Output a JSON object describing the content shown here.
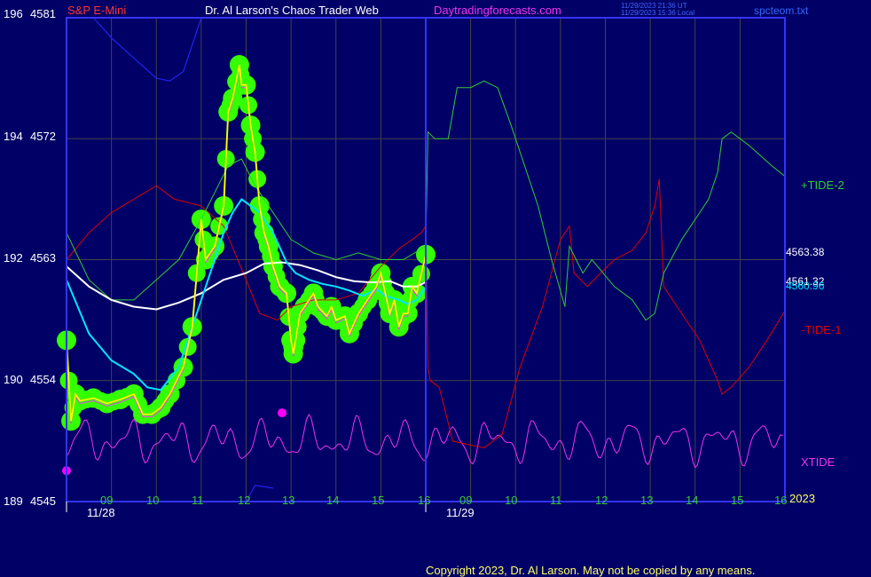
{
  "header": {
    "symbol": "S&P E-Mini",
    "author": "Dr. Al Larson's Chaos Trader Web",
    "site": "Daytradingforecasts.com",
    "ts_ut": "11/29/2023 21:36 UT",
    "ts_local": "11/29/2023 15:36 Local",
    "file": "spcteom.txt"
  },
  "footer": {
    "copyright": "Copyright 2023, Dr. Al Larson. May not be copied by any means."
  },
  "colors": {
    "background": "#000066",
    "frame": "#3333ff",
    "grid": "#444444",
    "price": "#ffff00",
    "glow": "#33ff00",
    "ema_fast": "#00e5ff",
    "ema_slow": "#ffffff",
    "tide_plus": "#33cc33",
    "tide_minus": "#dd0000",
    "xtide": "#ee33ee",
    "blue_line": "#2222ee",
    "markers": "#ff00ff"
  },
  "chart_data": {
    "type": "line",
    "title": "S&P E-Mini",
    "y_axis": {
      "ticks": [
        {
          "left": "196",
          "right": "4581"
        },
        {
          "left": "194",
          "right": "4572"
        },
        {
          "left": "192",
          "right": "4563"
        },
        {
          "left": "190",
          "right": "4554"
        },
        {
          "left": "189",
          "right": "4545"
        }
      ],
      "ylim": [
        4545,
        4581
      ]
    },
    "x_axis": {
      "hour_ticks": [
        "09",
        "10",
        "11",
        "12",
        "13",
        "14",
        "15",
        "16",
        "09",
        "10",
        "11",
        "12",
        "13",
        "14",
        "15",
        "16"
      ],
      "dates": [
        "11/28",
        "11/29"
      ],
      "year": "2023"
    },
    "right_labels": {
      "tide_plus": "+TIDE-2",
      "tide_minus": "-TIDE-1",
      "xtide": "XTIDE",
      "value_a": "4563.38",
      "value_b": "4561.32",
      "value_c": "4560.96"
    },
    "series": [
      {
        "name": "price",
        "points": [
          [
            8.0,
            4557
          ],
          [
            8.1,
            4551
          ],
          [
            8.2,
            4553
          ],
          [
            8.3,
            4552.5
          ],
          [
            8.6,
            4552.7
          ],
          [
            8.9,
            4552.3
          ],
          [
            9.2,
            4552.6
          ],
          [
            9.5,
            4553
          ],
          [
            9.7,
            4551.5
          ],
          [
            9.9,
            4551.5
          ],
          [
            10.1,
            4552
          ],
          [
            10.3,
            4553
          ],
          [
            10.6,
            4555
          ],
          [
            10.8,
            4558
          ],
          [
            11.0,
            4566
          ],
          [
            11.1,
            4563
          ],
          [
            11.3,
            4564
          ],
          [
            11.5,
            4567
          ],
          [
            11.6,
            4574
          ],
          [
            11.7,
            4575
          ],
          [
            11.85,
            4577.5
          ],
          [
            11.9,
            4576
          ],
          [
            12.0,
            4576
          ],
          [
            12.1,
            4573
          ],
          [
            12.2,
            4571
          ],
          [
            12.3,
            4567
          ],
          [
            12.4,
            4565
          ],
          [
            12.5,
            4564
          ],
          [
            12.6,
            4562.5
          ],
          [
            12.75,
            4561
          ],
          [
            12.9,
            4560.5
          ],
          [
            13.0,
            4557
          ],
          [
            13.05,
            4556
          ],
          [
            13.1,
            4557
          ],
          [
            13.2,
            4559
          ],
          [
            13.3,
            4559.5
          ],
          [
            13.5,
            4560.5
          ],
          [
            13.6,
            4559.5
          ],
          [
            13.8,
            4558.8
          ],
          [
            13.9,
            4559.5
          ],
          [
            14.0,
            4558.5
          ],
          [
            14.2,
            4558.8
          ],
          [
            14.3,
            4557.5
          ],
          [
            14.5,
            4559
          ],
          [
            14.7,
            4560
          ],
          [
            14.9,
            4561
          ],
          [
            15.0,
            4562
          ],
          [
            15.1,
            4560.5
          ],
          [
            15.2,
            4559
          ],
          [
            15.3,
            4560
          ],
          [
            15.4,
            4558
          ],
          [
            15.5,
            4559
          ],
          [
            15.6,
            4559
          ],
          [
            15.7,
            4561
          ],
          [
            15.8,
            4560.5
          ],
          [
            16.0,
            4563.38
          ]
        ]
      },
      {
        "name": "fast-avg",
        "points": [
          [
            8.0,
            4561.5
          ],
          [
            8.5,
            4557.5
          ],
          [
            9.0,
            4555.5
          ],
          [
            9.5,
            4554.5
          ],
          [
            9.8,
            4553.5
          ],
          [
            10.1,
            4553.3
          ],
          [
            10.5,
            4555
          ],
          [
            11.0,
            4560
          ],
          [
            11.5,
            4565
          ],
          [
            11.7,
            4566.5
          ],
          [
            11.9,
            4567.5
          ],
          [
            12.1,
            4567
          ],
          [
            12.3,
            4566.5
          ],
          [
            12.6,
            4565
          ],
          [
            12.9,
            4562.8
          ],
          [
            13.1,
            4562
          ],
          [
            13.4,
            4561.5
          ],
          [
            13.7,
            4561.2
          ],
          [
            14.0,
            4561
          ],
          [
            14.3,
            4560.7
          ],
          [
            14.6,
            4560.3
          ],
          [
            14.9,
            4560.8
          ],
          [
            15.1,
            4560.3
          ],
          [
            15.4,
            4560
          ],
          [
            15.6,
            4559.7
          ],
          [
            15.8,
            4560
          ],
          [
            16.0,
            4560.96
          ]
        ]
      },
      {
        "name": "slow-avg",
        "points": [
          [
            8.0,
            4562.5
          ],
          [
            8.5,
            4561
          ],
          [
            9.0,
            4560
          ],
          [
            9.5,
            4559.5
          ],
          [
            10.0,
            4559.3
          ],
          [
            10.5,
            4559.8
          ],
          [
            11.0,
            4560.5
          ],
          [
            11.5,
            4561.5
          ],
          [
            12.0,
            4562
          ],
          [
            12.4,
            4562.7
          ],
          [
            12.8,
            4562.8
          ],
          [
            13.2,
            4562.6
          ],
          [
            13.6,
            4562.2
          ],
          [
            14.0,
            4561.7
          ],
          [
            14.4,
            4561.4
          ],
          [
            14.8,
            4561.3
          ],
          [
            15.2,
            4561.4
          ],
          [
            15.5,
            4561
          ],
          [
            15.8,
            4561
          ],
          [
            16.0,
            4561.32
          ]
        ]
      },
      {
        "name": "+TIDE-2",
        "points": [
          [
            8.0,
            4565
          ],
          [
            8.5,
            4561.5
          ],
          [
            9.0,
            4560
          ],
          [
            9.5,
            4560
          ],
          [
            10.0,
            4561.5
          ],
          [
            10.5,
            4563
          ],
          [
            11.0,
            4566
          ],
          [
            11.3,
            4568
          ],
          [
            11.6,
            4570
          ],
          [
            11.9,
            4570.5
          ],
          [
            12.2,
            4568.5
          ],
          [
            12.6,
            4566.5
          ],
          [
            13.0,
            4564.5
          ],
          [
            13.5,
            4563.5
          ],
          [
            14.0,
            4563
          ],
          [
            14.5,
            4563.5
          ],
          [
            15.0,
            4563
          ],
          [
            15.5,
            4563
          ],
          [
            16.0,
            4564
          ],
          [
            16.05,
            4572.5
          ],
          [
            16.2,
            4572
          ],
          [
            16.5,
            4572
          ],
          [
            16.7,
            4575.8
          ],
          [
            17.0,
            4575.8
          ],
          [
            17.3,
            4576.3
          ],
          [
            17.6,
            4575.8
          ],
          [
            17.9,
            4573
          ],
          [
            18.2,
            4570
          ],
          [
            18.5,
            4567
          ],
          [
            18.8,
            4563
          ],
          [
            19.1,
            4559.5
          ],
          [
            19.2,
            4564
          ],
          [
            19.5,
            4562
          ],
          [
            19.7,
            4563
          ],
          [
            19.9,
            4562.2
          ],
          [
            20.2,
            4561
          ],
          [
            20.6,
            4560
          ],
          [
            20.9,
            4558.5
          ],
          [
            21.1,
            4559
          ],
          [
            21.3,
            4562
          ],
          [
            21.7,
            4564.5
          ],
          [
            22.0,
            4566
          ],
          [
            22.3,
            4567.5
          ],
          [
            22.5,
            4569.5
          ],
          [
            22.6,
            4572
          ],
          [
            22.8,
            4572.5
          ],
          [
            23.2,
            4571.5
          ],
          [
            23.7,
            4570
          ],
          [
            24.0,
            4569.2
          ]
        ]
      },
      {
        "name": "-TIDE-1",
        "points": [
          [
            8.0,
            4563
          ],
          [
            8.5,
            4565
          ],
          [
            9.0,
            4566.5
          ],
          [
            9.5,
            4567.5
          ],
          [
            10.0,
            4568.5
          ],
          [
            10.4,
            4567.5
          ],
          [
            11.0,
            4567
          ],
          [
            11.5,
            4565.5
          ],
          [
            12.0,
            4561.5
          ],
          [
            12.3,
            4559
          ],
          [
            12.7,
            4558.5
          ],
          [
            13.0,
            4559.5
          ],
          [
            13.5,
            4560
          ],
          [
            14.0,
            4560
          ],
          [
            14.5,
            4560.5
          ],
          [
            15.0,
            4562.5
          ],
          [
            15.4,
            4563.8
          ],
          [
            15.7,
            4564.5
          ],
          [
            15.9,
            4565
          ],
          [
            16.0,
            4565.5
          ],
          [
            16.05,
            4555
          ],
          [
            16.1,
            4554
          ],
          [
            16.3,
            4553.5
          ],
          [
            16.6,
            4549.5
          ],
          [
            17.0,
            4549.2
          ],
          [
            17.3,
            4549
          ],
          [
            17.7,
            4550
          ],
          [
            18.1,
            4555
          ],
          [
            18.6,
            4559.5
          ],
          [
            19.0,
            4564.5
          ],
          [
            19.2,
            4565.5
          ],
          [
            19.3,
            4562
          ],
          [
            19.6,
            4561
          ],
          [
            19.9,
            4562
          ],
          [
            20.2,
            4563
          ],
          [
            20.6,
            4563.7
          ],
          [
            20.9,
            4565
          ],
          [
            21.1,
            4567
          ],
          [
            21.2,
            4569
          ],
          [
            21.3,
            4561
          ],
          [
            21.7,
            4559
          ],
          [
            22.1,
            4557
          ],
          [
            22.5,
            4554
          ],
          [
            22.6,
            4553
          ],
          [
            22.8,
            4553.5
          ],
          [
            23.2,
            4555
          ],
          [
            23.6,
            4557
          ],
          [
            24.0,
            4559.2
          ]
        ]
      },
      {
        "name": "blue-line",
        "points": [
          [
            8.6,
            4581
          ],
          [
            9.0,
            4579.5
          ],
          [
            9.5,
            4578
          ],
          [
            10.0,
            4576.5
          ],
          [
            10.3,
            4576.3
          ],
          [
            10.6,
            4577
          ],
          [
            10.8,
            4579
          ],
          [
            11.0,
            4581
          ]
        ]
      },
      {
        "name": "blue-line-low",
        "points": [
          [
            12.0,
            4545
          ],
          [
            12.2,
            4546.2
          ],
          [
            12.6,
            4546
          ]
        ]
      },
      {
        "name": "markers",
        "points": [
          [
            8.0,
            4547.3
          ],
          [
            12.8,
            4551.6
          ]
        ]
      }
    ]
  }
}
